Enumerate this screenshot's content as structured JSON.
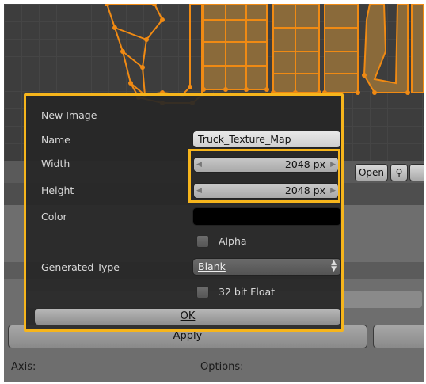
{
  "dialog": {
    "title": "New Image",
    "name_label": "Name",
    "name_value": "Truck_Texture_Map",
    "width_label": "Width",
    "width_value": "2048 px",
    "height_label": "Height",
    "height_value": "2048 px",
    "color_label": "Color",
    "color_value": "#000000",
    "alpha_label": "Alpha",
    "generated_type_label": "Generated Type",
    "generated_type_value": "Blank",
    "float_label": "32 bit Float",
    "ok_label": "OK"
  },
  "background": {
    "header_open_label": "Open",
    "apply_label": "Apply",
    "axis_label": "Axis:",
    "options_label": "Options:"
  },
  "colors": {
    "highlight": "#f6b51c",
    "uv_mesh": "#f08a13",
    "uv_face": "#8a6a3a"
  }
}
